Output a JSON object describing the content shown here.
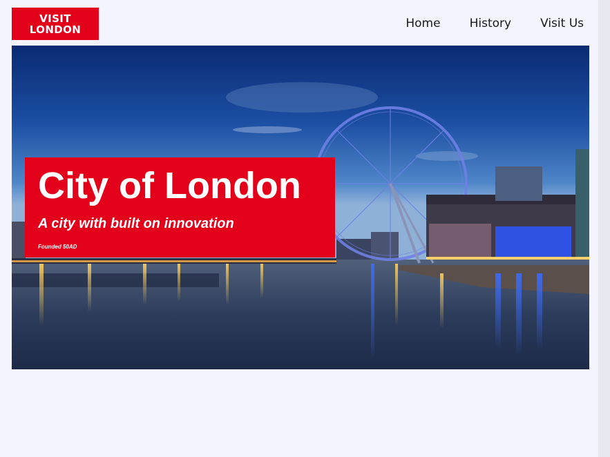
{
  "logo": {
    "line1": "VISIT",
    "line2": "LONDON"
  },
  "nav": {
    "items": [
      {
        "label": "Home"
      },
      {
        "label": "History"
      },
      {
        "label": "Visit Us"
      }
    ]
  },
  "hero": {
    "image": "london-eye-thames-night-photo",
    "title": "City of London",
    "subtitle": "A city with built on innovation",
    "founded": "Founded 50AD"
  },
  "colors": {
    "brand_red": "#e2001a",
    "page_bg": "#f3f4fd"
  }
}
